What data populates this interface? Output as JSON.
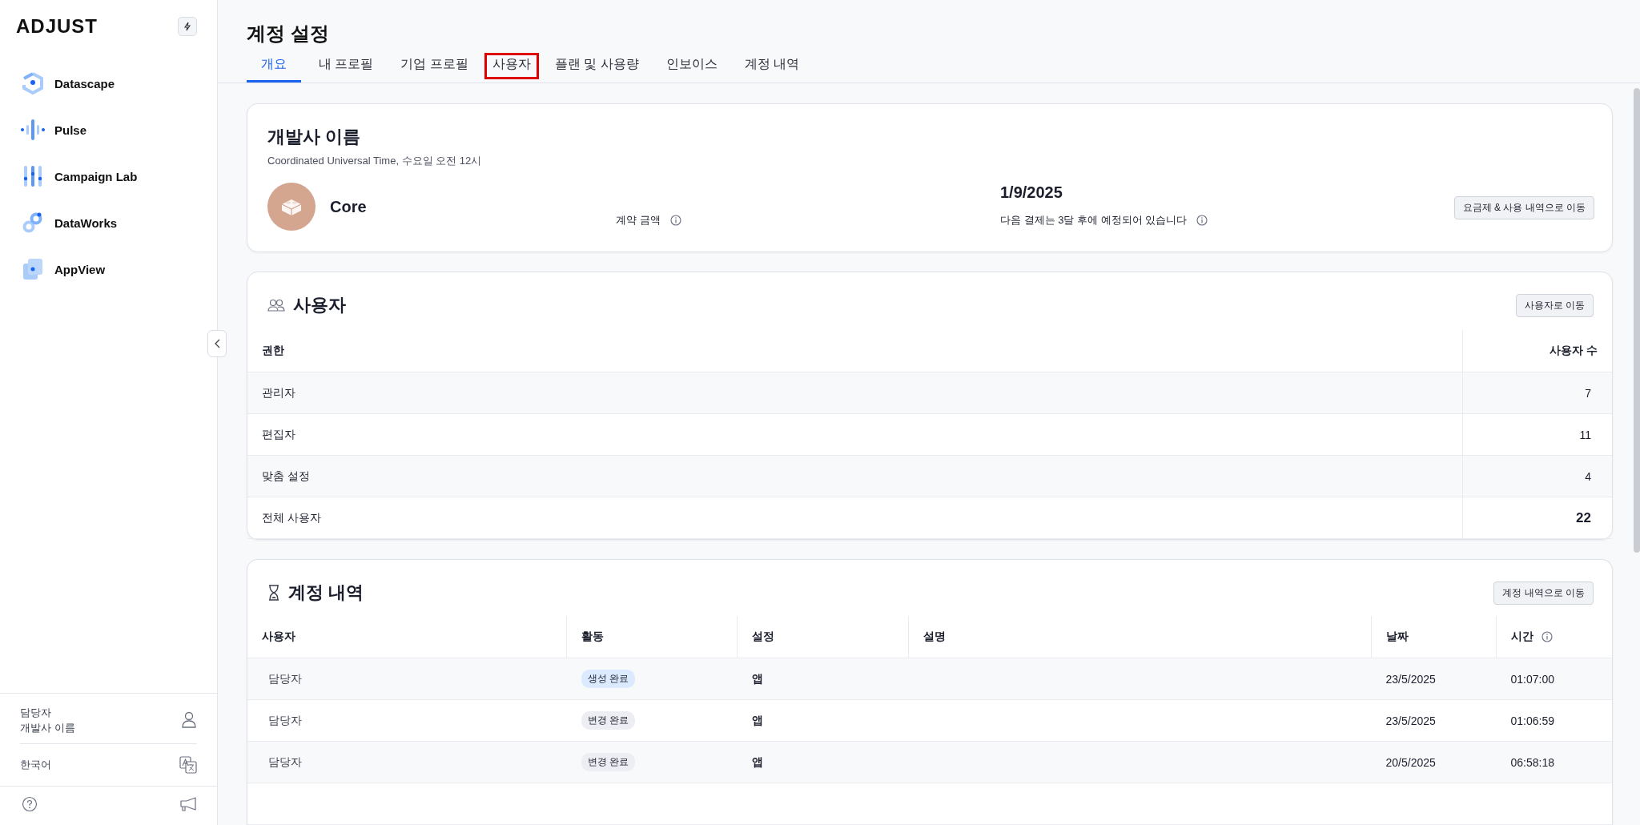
{
  "sidebar": {
    "logo": "ADJUST",
    "nav_items": [
      {
        "label": "Datascape",
        "kind": "datascape"
      },
      {
        "label": "Pulse",
        "kind": "pulse"
      },
      {
        "label": "Campaign Lab",
        "kind": "campaign"
      },
      {
        "label": "DataWorks",
        "kind": "dataworks"
      },
      {
        "label": "AppView",
        "kind": "appview"
      }
    ],
    "account": {
      "role": "담당자",
      "name": "개발사 이름"
    },
    "language": "한국어"
  },
  "header": {
    "title": "계정 설정",
    "tabs": [
      {
        "label": "개요",
        "selected": true,
        "annotated": false
      },
      {
        "label": "내 프로필",
        "selected": false,
        "annotated": false
      },
      {
        "label": "기업 프로필",
        "selected": false,
        "annotated": false
      },
      {
        "label": "사용자",
        "selected": false,
        "annotated": true
      },
      {
        "label": "플랜 및 사용량",
        "selected": false,
        "annotated": false
      },
      {
        "label": "인보이스",
        "selected": false,
        "annotated": false
      },
      {
        "label": "계정 내역",
        "selected": false,
        "annotated": false
      }
    ]
  },
  "overview": {
    "title": "개발사 이름",
    "subtitle": "Coordinated Universal Time, 수요일 오전 12시",
    "plan": "Core",
    "contract_label": "계약 금액",
    "billing_date": "1/9/2025",
    "billing_note": "다음 결제는 3달 후에 예정되어 있습니다",
    "button": "요금제 & 사용 내역으로 이동"
  },
  "users": {
    "title": "사용자",
    "button": "사용자로 이동",
    "columns": [
      "권한",
      "사용자 수"
    ],
    "rows": [
      {
        "role": "관리자",
        "count": "7",
        "total": false
      },
      {
        "role": "편집자",
        "count": "11",
        "total": false
      },
      {
        "role": "맞춤 설정",
        "count": "4",
        "total": false
      },
      {
        "role": "전체 사용자",
        "count": "22",
        "total": true
      }
    ]
  },
  "history": {
    "title": "계정 내역",
    "button": "계정 내역으로 이동",
    "columns": [
      "사용자",
      "활동",
      "설정",
      "설명",
      "날짜",
      "시간"
    ],
    "rows": [
      {
        "user": "담당자",
        "activity": "생성 완료",
        "color": "#dbeafe",
        "setting": "앱",
        "date": "23/5/2025",
        "time": "01:07:00"
      },
      {
        "user": "담당자",
        "activity": "변경 완료",
        "color": "#eceef3",
        "setting": "앱",
        "date": "23/5/2025",
        "time": "01:06:59"
      },
      {
        "user": "담당자",
        "activity": "변경 완료",
        "color": "#eceef3",
        "setting": "앱",
        "date": "20/5/2025",
        "time": "06:58:18"
      }
    ]
  }
}
